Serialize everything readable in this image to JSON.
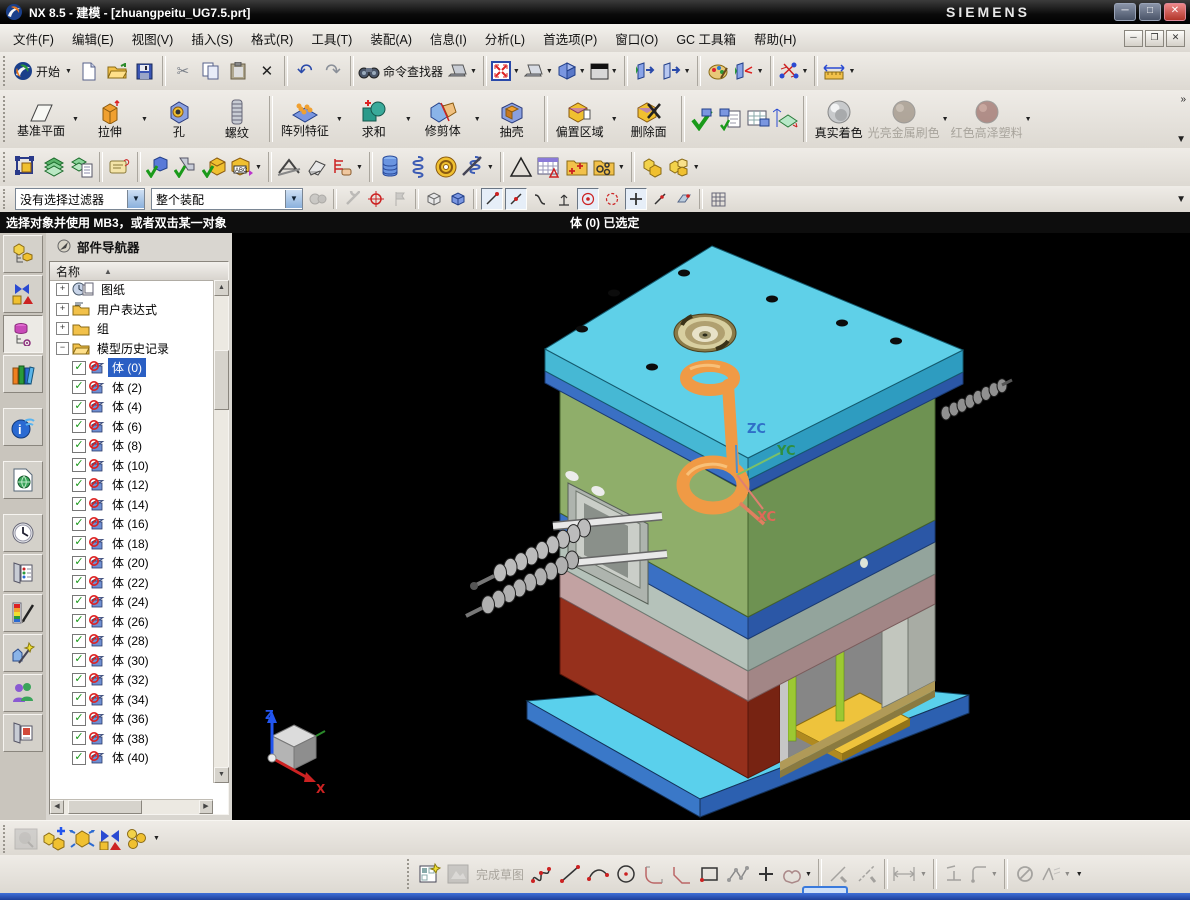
{
  "window": {
    "title": "NX 8.5 - 建模 - [zhuangpeitu_UG7.5.prt]",
    "brand": "SIEMENS"
  },
  "menu": {
    "items": [
      "文件(F)",
      "编辑(E)",
      "视图(V)",
      "插入(S)",
      "格式(R)",
      "工具(T)",
      "装配(A)",
      "信息(I)",
      "分析(L)",
      "首选项(P)",
      "窗口(O)",
      "GC 工具箱",
      "帮助(H)"
    ]
  },
  "toolbar_standard": {
    "start_label": "开始",
    "command_finder_label": "命令查找器"
  },
  "toolbar_feature": {
    "buttons": [
      "基准平面",
      "拉伸",
      "孔",
      "螺纹",
      "阵列特征",
      "求和",
      "修剪体",
      "抽壳",
      "偏置区域",
      "删除面",
      "真实着色",
      "光亮金属刷色",
      "红色高泽塑料"
    ]
  },
  "selection_bar": {
    "filter": "没有选择过滤器",
    "scope": "整个装配"
  },
  "prompt_bar": {
    "message": "选择对象并使用 MB3，或者双击某一对象",
    "status": "体 (0) 已选定"
  },
  "part_navigator": {
    "title": "部件导航器",
    "name_column": "名称",
    "groups": [
      "图纸",
      "用户表达式",
      "组",
      "模型历史记录"
    ],
    "bodies": [
      "体 (0)",
      "体 (2)",
      "体 (4)",
      "体 (6)",
      "体 (8)",
      "体 (10)",
      "体 (12)",
      "体 (14)",
      "体 (16)",
      "体 (18)",
      "体 (20)",
      "体 (22)",
      "体 (24)",
      "体 (26)",
      "体 (28)",
      "体 (30)",
      "体 (32)",
      "体 (34)",
      "体 (36)",
      "体 (38)",
      "体 (40)"
    ],
    "selected_body": "体 (0)"
  },
  "viewport": {
    "wcs_labels": {
      "z": "ZC",
      "y": "YC",
      "x": "XC"
    },
    "triad_labels": {
      "z": "Z",
      "x": "X"
    }
  },
  "sketch_bar": {
    "finish_label": "完成草图"
  },
  "colors": {
    "selection": "#2a5fc4",
    "viewport_background": "#000000",
    "top_plate": "#5fd0e8",
    "mold_block": "#8fae6a",
    "base_block": "#96301c",
    "bottom_plate": "#58c8e8",
    "highlight_spring": "#f09a45"
  }
}
